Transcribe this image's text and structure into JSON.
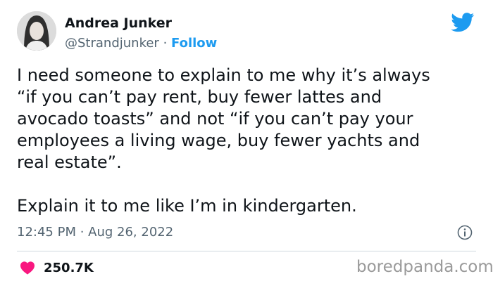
{
  "tweet": {
    "author": {
      "name": "Andrea Junker",
      "handle": "@Strandjunker",
      "separator": "·",
      "follow_label": "Follow"
    },
    "text_lines": [
      "I need someone to explain to me why it’s always",
      "“if you can’t pay rent, buy fewer lattes and",
      "avocado toasts” and not “if you can’t pay your",
      "employees a living wage, buy fewer yachts and",
      "real estate”."
    ],
    "text_tail": "Explain it to me like I’m in kindergarten.",
    "timestamp": "12:45 PM · Aug 26, 2022",
    "likes": "250.7K"
  },
  "watermark": "boredpanda.com",
  "colors": {
    "accent": "#1d9bf0",
    "heart": "#f91880",
    "secondary_text": "#536471",
    "primary_text": "#0f1419"
  },
  "icons": {
    "platform": "twitter-bird-icon",
    "info": "info-icon",
    "like": "heart-icon"
  }
}
